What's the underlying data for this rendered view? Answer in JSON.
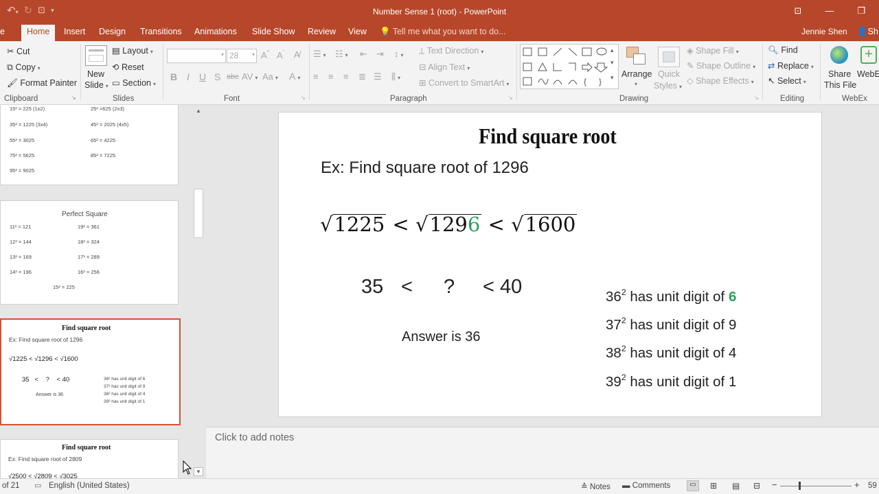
{
  "window": {
    "doc_title": "Number Sense 1 (root) - PowerPoint",
    "user": "Jennie Shen",
    "share_glyph": "Sh"
  },
  "tabs": [
    "e",
    "Home",
    "Insert",
    "Design",
    "Transitions",
    "Animations",
    "Slide Show",
    "Review",
    "View"
  ],
  "tell_me": "Tell me what you want to do...",
  "ribbon": {
    "clipboard": {
      "cut": "Cut",
      "copy": "Copy",
      "format_painter": "Format Painter",
      "label": "Clipboard"
    },
    "slides": {
      "new_slide_1": "New",
      "new_slide_2": "Slide",
      "layout": "Layout",
      "reset": "Reset",
      "section": "Section",
      "label": "Slides"
    },
    "font": {
      "size": "28",
      "label": "Font"
    },
    "paragraph": {
      "text_direction": "Text Direction",
      "align_text": "Align Text",
      "smartart": "Convert to SmartArt",
      "label": "Paragraph"
    },
    "drawing": {
      "arrange": "Arrange",
      "quick_styles_1": "Quick",
      "quick_styles_2": "Styles",
      "shape_fill": "Shape Fill",
      "shape_outline": "Shape Outline",
      "shape_effects": "Shape Effects",
      "label": "Drawing"
    },
    "editing": {
      "find": "Find",
      "replace": "Replace",
      "select": "Select",
      "label": "Editing"
    },
    "webex": {
      "share_1": "Share",
      "share_2": "This File",
      "webex_btn": "WebE",
      "label": "WebEx"
    }
  },
  "thumbnails": {
    "t1": {
      "left": [
        "15² = 225 (1x2)",
        "35² = 1225 (3x4)",
        "55² = 3025",
        "75² = 5625",
        "95² = 9025"
      ],
      "right": [
        "25² =625 (2x3)",
        "45² = 2025 (4x5)",
        "65² = 4225",
        "85² = 7225"
      ]
    },
    "t2": {
      "title": "Perfect Square",
      "left": [
        "11² = 121",
        "12² = 144",
        "13² = 169",
        "14² = 196"
      ],
      "right": [
        "19² = 361",
        "18² = 324",
        "17² = 289",
        "16² = 256"
      ],
      "bottom": "15² = 225"
    },
    "t3": {
      "title": "Find square root",
      "ex": "Ex: Find square root of 1296",
      "ineq": "√1225 < √1296 < √1600",
      "range": "35   <    ?    < 40",
      "answer": "Answer is 36",
      "digits": [
        "36² has unit digit of 6",
        "37² has unit digit of 9",
        "38² has unit digit of 4",
        "39² has unit digit of 1"
      ]
    },
    "t4": {
      "title": "Find square root",
      "ex": "Ex: Find square root of 2809",
      "ineq": "√2500 < √2809 < √3025"
    }
  },
  "slide": {
    "title": "Find square root",
    "example": "Ex: Find square root of 1296",
    "sqrt_a": "1225",
    "lt": "<",
    "sqrt_b_prefix": "129",
    "sqrt_b_last": "6",
    "sqrt_c": "1600",
    "low": "35",
    "q": "?",
    "high": "< 40",
    "answer": "Answer is 36",
    "digit_rows": [
      {
        "base": "36",
        "exp": "2",
        "text": " has unit digit of ",
        "digit": "6"
      },
      {
        "base": "37",
        "exp": "2",
        "text": " has unit digit of ",
        "digit": "9"
      },
      {
        "base": "38",
        "exp": "2",
        "text": " has unit digit of ",
        "digit": "4"
      },
      {
        "base": "39",
        "exp": "2",
        "text": " has unit digit of ",
        "digit": "1"
      }
    ]
  },
  "notes_placeholder": "Click to add notes",
  "status": {
    "slide_of": "of 21",
    "language": "English (United States)",
    "notes": "Notes",
    "comments": "Comments",
    "zoom": "59"
  },
  "colors": {
    "accent": "#b7472a",
    "selected_border": "#d35230",
    "highlight_green": "#2aa05a"
  }
}
